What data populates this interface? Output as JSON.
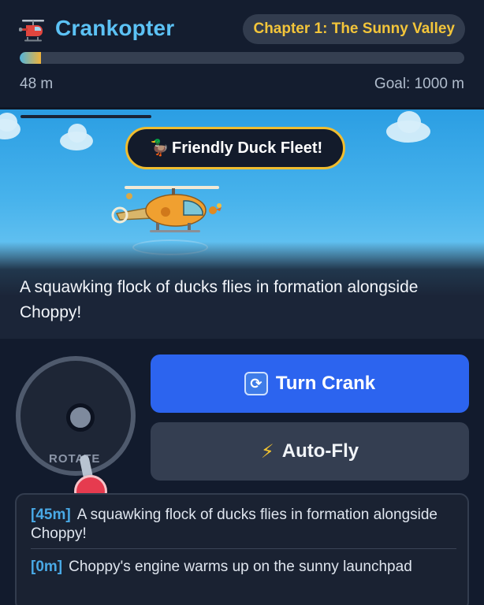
{
  "header": {
    "logo_icon": "helicopter-icon",
    "title": "Crankopter",
    "chapter": "Chapter 1: The Sunny Valley",
    "progress_fraction": 0.048,
    "distance": "48 m",
    "goal": "Goal: 1000 m"
  },
  "scene": {
    "badge_icon": "duck-icon",
    "badge_text": "Friendly Duck Fleet!",
    "event_text": "A squawking flock of ducks flies in formation alongside Choppy!"
  },
  "controls": {
    "crank_label": "ROTATE",
    "turn_crank_icon": "refresh-icon",
    "turn_crank_label": "Turn Crank",
    "auto_fly_icon": "lightning-icon",
    "auto_fly_label": "Auto-Fly"
  },
  "log": [
    {
      "dist": "[45m]",
      "text": "A squawking flock of ducks flies in formation alongside Choppy!"
    },
    {
      "dist": "[0m]",
      "text": "Choppy's engine warms up on the sunny launchpad"
    }
  ],
  "colors": {
    "accent_blue": "#2c64ef",
    "title_blue": "#5cc2f5",
    "chapter_gold": "#f3c53a",
    "knob_red": "#e63b4f"
  }
}
